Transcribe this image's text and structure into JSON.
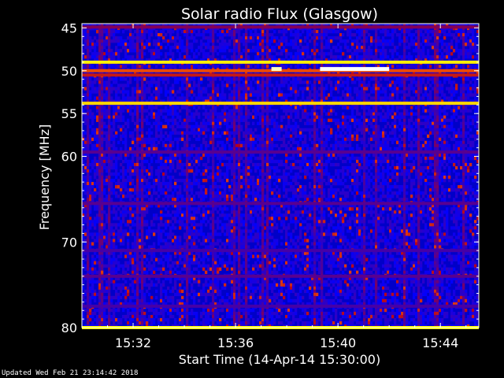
{
  "chart_data": {
    "type": "heatmap",
    "title": "Solar radio Flux (Glasgow)",
    "xlabel": "Start Time (14-Apr-14 15:30:00)",
    "ylabel": "Frequency [MHz]",
    "x_unit": "minutes after 15:30:00",
    "xlim": [
      0,
      15.5
    ],
    "ylim": [
      80,
      44.5
    ],
    "y_scale": "linear, top = low frequency",
    "x_ticks": [
      {
        "value": 2,
        "label": "15:32"
      },
      {
        "value": 6,
        "label": "15:36"
      },
      {
        "value": 10,
        "label": "15:40"
      },
      {
        "value": 14,
        "label": "15:44"
      }
    ],
    "y_ticks": [
      {
        "value": 45,
        "label": "45"
      },
      {
        "value": 50,
        "label": "50"
      },
      {
        "value": 55,
        "label": "55"
      },
      {
        "value": 60,
        "label": "60"
      },
      {
        "value": 70,
        "label": "70"
      },
      {
        "value": 80,
        "label": "80"
      }
    ],
    "colorscale": [
      "#000060",
      "#0000ff",
      "#b00020",
      "#ff6000",
      "#ffff00",
      "#ffffff"
    ],
    "bright_bands_mhz": [
      {
        "freq": 44.9,
        "level": 0.35
      },
      {
        "freq": 49.0,
        "level": 0.78
      },
      {
        "freq": 50.0,
        "level": 0.55
      },
      {
        "freq": 50.5,
        "level": 0.45
      },
      {
        "freq": 53.8,
        "level": 0.75
      },
      {
        "freq": 59.5,
        "level": 0.3
      },
      {
        "freq": 65.5,
        "level": 0.3
      },
      {
        "freq": 71.0,
        "level": 0.28
      },
      {
        "freq": 74.0,
        "level": 0.3
      },
      {
        "freq": 77.5,
        "level": 0.28
      },
      {
        "freq": 80.0,
        "level": 0.8
      }
    ],
    "bursts": [
      {
        "t_start": 7.4,
        "t_end": 7.8,
        "freq": 49.8,
        "level": 0.95
      },
      {
        "t_start": 9.3,
        "t_end": 12.0,
        "freq": 49.8,
        "level": 1.0
      }
    ]
  },
  "footer": "Updated Wed Feb 21 23:14:42 2018"
}
